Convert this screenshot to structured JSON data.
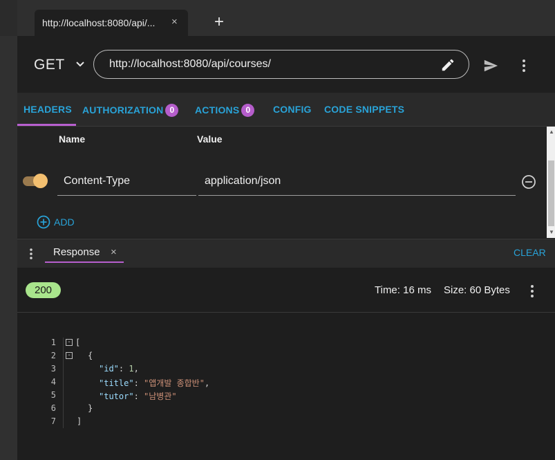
{
  "browser_tab": {
    "title": "http://localhost:8080/api/...",
    "close_glyph": "×",
    "new_tab_glyph": "+"
  },
  "request": {
    "method": "GET",
    "url": "http://localhost:8080/api/courses/"
  },
  "request_tabs": [
    {
      "label": "HEADERS",
      "active": true
    },
    {
      "label": "AUTHORIZATION",
      "badge": "0"
    },
    {
      "label": "ACTIONS",
      "badge": "0"
    },
    {
      "label": "CONFIG"
    },
    {
      "label": "CODE SNIPPETS"
    }
  ],
  "headers_table": {
    "columns": [
      "Name",
      "Value"
    ],
    "rows": [
      {
        "enabled": true,
        "name": "Content-Type",
        "value": "application/json"
      }
    ],
    "add_label": "ADD"
  },
  "response_panel": {
    "tab_label": "Response",
    "close_glyph": "×",
    "clear_label": "CLEAR",
    "status_code": "200",
    "time": "Time: 16 ms",
    "size": "Size: 60 Bytes"
  },
  "response_body": {
    "line_numbers": [
      "1",
      "2",
      "3",
      "4",
      "5",
      "6",
      "7"
    ],
    "fold_glyph": "-",
    "lines": {
      "l1": "[",
      "l2": "{",
      "id_key": "\"id\"",
      "id_val": "1",
      "title_key": "\"title\"",
      "title_val": "\"앱개발 종합반\"",
      "tutor_key": "\"tutor\"",
      "tutor_val": "\"남병관\"",
      "colon": ": ",
      "comma": ",",
      "l6": "}",
      "l7": "]"
    }
  },
  "colors": {
    "accent_blue": "#29a3d8",
    "accent_purple": "#b85fcf",
    "status_ok": "#a9e58c",
    "toggle_on": "#f3bf70"
  },
  "icons": [
    "close-icon",
    "plus-icon",
    "chevron-down-icon",
    "pencil-icon",
    "send-icon",
    "more-vert-icon",
    "remove-circle-icon",
    "add-circle-icon"
  ]
}
